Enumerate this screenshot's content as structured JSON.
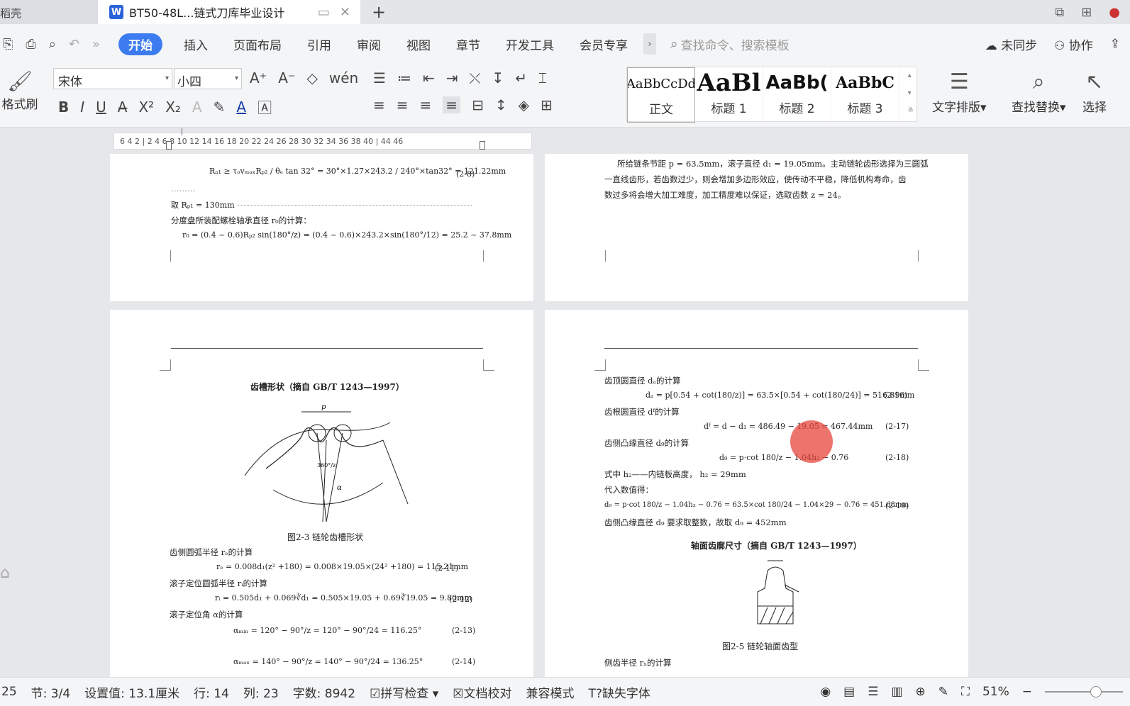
{
  "tabs": {
    "left_tab": "稻壳",
    "active_tab": "BT50-48L...链式刀库毕业设计",
    "new_tab": "+"
  },
  "menu": {
    "items": [
      "开始",
      "插入",
      "页面布局",
      "引用",
      "审阅",
      "视图",
      "章节",
      "开发工具",
      "会员专享"
    ],
    "more": "›",
    "search_placeholder": "查找命令、搜索模板",
    "sync": "未同步",
    "collab": "协作"
  },
  "ribbon": {
    "format_painter": "格式刷",
    "font_name": "宋体",
    "font_size": "小四",
    "styles": [
      {
        "preview": "AaBbCcDd",
        "label": "正文"
      },
      {
        "preview": "AaBl",
        "label": "标题 1"
      },
      {
        "preview": "AaBb(",
        "label": "标题 2"
      },
      {
        "preview": "AaBbC",
        "label": "标题 3"
      }
    ],
    "text_layout": "文字排版",
    "find_replace": "查找替换",
    "select": "选择"
  },
  "ruler": {
    "numbers": "6   4   2   |   2   4   6   8  10  12  14  16  18  20  22  24  26  28  30  32  34  36  38  40  |  44  46"
  },
  "page1": {
    "eq1": "Rₐ₁ ≥ τₒvₘₐₓRₚ₂ / θₑ tan 32° = 30°×1.27×243.2 / 240°×tan32° = 121.22mm",
    "eq1_num": "(2-8)",
    "dots": "………",
    "take": "取 Rₚ₁ = 130mm",
    "calc_title": "分度盘所装配螺栓轴承直径 r₀的计算：",
    "eq2": "r₀ = (0.4 ~ 0.6)Rₚ₂ sin(180°/z) = (0.4 ~ 0.6)×243.2×sin(180°/12) = 25.2 ~ 37.8mm"
  },
  "page2": {
    "line1": "所给链条节距 p = 63.5mm，滚子直径 d₁ = 19.05mm。主动链轮齿形选择为三圆弧",
    "line2": "一直线齿形，若齿数过少，则会增加多边形效应，使传动不平稳，降低机构寿命，齿",
    "line3": "数过多将会增大加工难度，加工精度难以保证，选取齿数 z = 24。"
  },
  "page3": {
    "fig_title": "齿槽形状（摘自 GB/T 1243—1997）",
    "caption": "图2-3  链轮齿槽形状",
    "re_title": "齿侧圆弧半径 rₑ的计算",
    "re_eq": "rₑ = 0.008d₁(z² +180) = 0.008×19.05×(24² +180) = 115.21mm",
    "re_num": "(2-11)",
    "ri_title": "滚子定位圆弧半径 rᵢ的计算",
    "ri_eq": "rᵢ = 0.505d₁ + 0.069∛d₁ = 0.505×19.05 + 0.69∛19.05 = 9.80mm",
    "ri_num": "(2-12)",
    "alpha_title": "滚子定位角 α的计算",
    "a1_eq": "αₘᵢₙ = 120° − 90°/z = 120° − 90°/24 = 116.25°",
    "a1_num": "(2-13)",
    "a2_eq": "αₘₐₓ = 140° − 90°/z = 140° − 90°/24 = 136.25°",
    "a2_num": "(2-14)"
  },
  "page4": {
    "da_title": "齿顶圆直径 dₐ的计算",
    "da_eq": "dₐ = p[0.54 + cot(180/z)] = 63.5×[0.54 + cot(180/24)] = 516.89mm",
    "da_num": "(2-16)",
    "df_title": "齿根圆直径 dᶠ的计算",
    "df_eq": "dᶠ = d − d₁ = 486.49 − 19.05 = 467.44mm",
    "df_num": "(2-17)",
    "dg_title": "齿侧凸缘直径 d₉的计算",
    "dg_eq": "d₉ = p·cot 180/z − 1.04h₂ − 0.76",
    "dg_num": "(2-18)",
    "h2_note": "式中  h₂——内链板高度，  h₂ = 29mm",
    "sub_title": "代入数值得：",
    "dg2_eq": "d₉ = p·cot 180/z − 1.04h₂ − 0.76 = 63.5×cot 180/24 − 1.04×29 − 0.76 = 451.68mm",
    "dg2_num": "(2-19)",
    "dg_round": "齿侧凸缘直径 d₉ 要求取整数，故取 d₉ = 452mm",
    "fig_title": "轴面齿廓尺寸（摘自 GB/T 1243—1997）",
    "caption": "图2-5  链轮轴面齿型",
    "rx_title": "侧齿半径 rₓ的计算"
  },
  "status": {
    "page": "25",
    "section": "节: 3/4",
    "setting": "设置值: 13.1厘米",
    "row": "行: 14",
    "col": "列: 23",
    "words": "字数: 8942",
    "spell": "拼写检查",
    "proof": "文档校对",
    "compat": "兼容模式",
    "font_missing": "缺失字体",
    "zoom": "51%"
  }
}
